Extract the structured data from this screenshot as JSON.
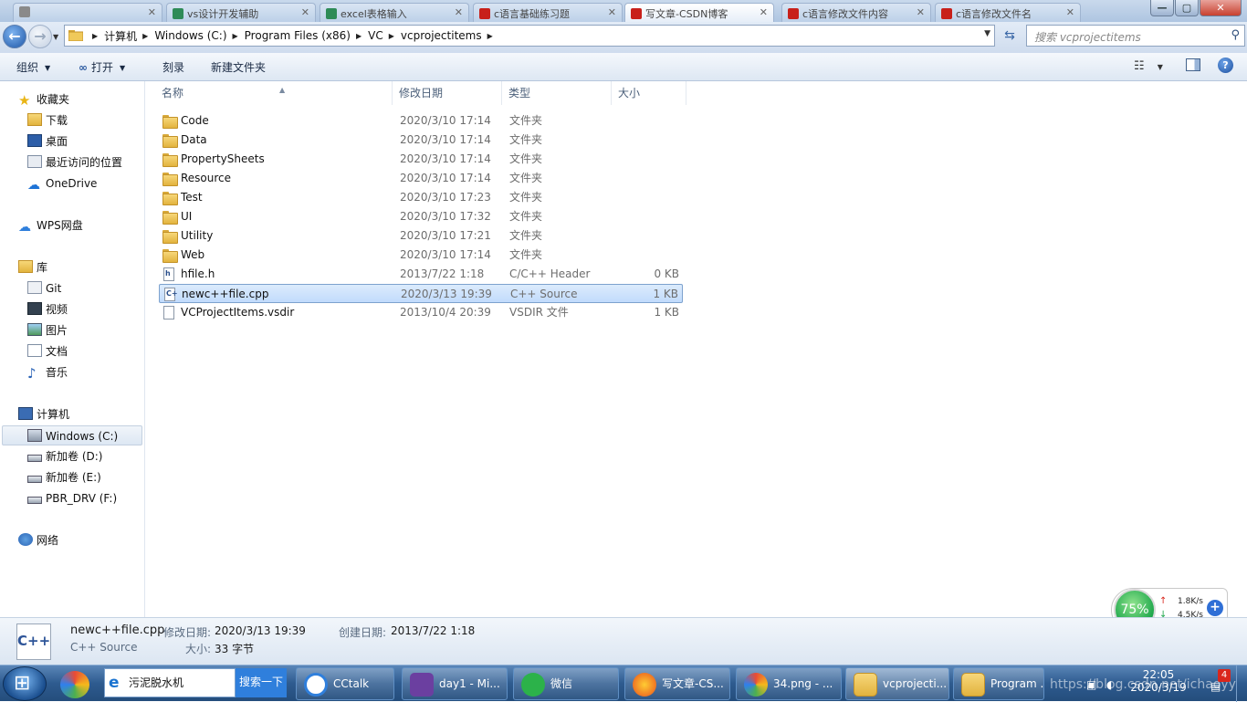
{
  "browser_tabs": [
    {
      "title": "",
      "color": "#8a8a8a"
    },
    {
      "title": "vs设计开发辅助",
      "color": "#2e8b57"
    },
    {
      "title": "excel表格输入",
      "color": "#2e8b57"
    },
    {
      "title": "c语言基础练习题",
      "color": "#c8201a"
    },
    {
      "title": "写文章-CSDN博客",
      "color": "#c8201a"
    },
    {
      "title": "c语言修改文件内容",
      "color": "#c8201a"
    },
    {
      "title": "c语言修改文件名",
      "color": "#c8201a"
    }
  ],
  "address": {
    "crumbs": [
      "计算机",
      "Windows (C:)",
      "Program Files (x86)",
      "VC",
      "vcprojectitems"
    ],
    "search_placeholder": "搜索 vcprojectitems"
  },
  "toolbar": {
    "organize": "组织",
    "open": "打开",
    "burn": "刻录",
    "new_folder": "新建文件夹"
  },
  "nav": {
    "favorites": "收藏夹",
    "downloads": "下载",
    "desktop": "桌面",
    "recent": "最近访问的位置",
    "onedrive": "OneDrive",
    "wps": "WPS网盘",
    "library": "库",
    "git": "Git",
    "video": "视频",
    "pictures": "图片",
    "documents": "文档",
    "music": "音乐",
    "computer": "计算机",
    "drive_c": "Windows (C:)",
    "drive_d": "新加卷 (D:)",
    "drive_e": "新加卷 (E:)",
    "drive_f": "PBR_DRV (F:)",
    "network": "网络"
  },
  "columns": {
    "name": "名称",
    "date": "修改日期",
    "type": "类型",
    "size": "大小"
  },
  "files": [
    {
      "name": "Code",
      "date": "2020/3/10 17:14",
      "type": "文件夹",
      "size": "",
      "icon": "folder"
    },
    {
      "name": "Data",
      "date": "2020/3/10 17:14",
      "type": "文件夹",
      "size": "",
      "icon": "folder"
    },
    {
      "name": "PropertySheets",
      "date": "2020/3/10 17:14",
      "type": "文件夹",
      "size": "",
      "icon": "folder"
    },
    {
      "name": "Resource",
      "date": "2020/3/10 17:14",
      "type": "文件夹",
      "size": "",
      "icon": "folder"
    },
    {
      "name": "Test",
      "date": "2020/3/10 17:23",
      "type": "文件夹",
      "size": "",
      "icon": "folder"
    },
    {
      "name": "UI",
      "date": "2020/3/10 17:32",
      "type": "文件夹",
      "size": "",
      "icon": "folder"
    },
    {
      "name": "Utility",
      "date": "2020/3/10 17:21",
      "type": "文件夹",
      "size": "",
      "icon": "folder"
    },
    {
      "name": "Web",
      "date": "2020/3/10 17:14",
      "type": "文件夹",
      "size": "",
      "icon": "folder"
    },
    {
      "name": "hfile.h",
      "date": "2013/7/22 1:18",
      "type": "C/C++ Header",
      "size": "0 KB",
      "icon": "h-file"
    },
    {
      "name": "newc++file.cpp",
      "date": "2020/3/13 19:39",
      "type": "C++ Source",
      "size": "1 KB",
      "icon": "cpp-file",
      "selected": true
    },
    {
      "name": "VCProjectItems.vsdir",
      "date": "2013/10/4 20:39",
      "type": "VSDIR 文件",
      "size": "1 KB",
      "icon": "blank-file"
    }
  ],
  "details": {
    "icon_text": "C++",
    "filename": "newc++file.cpp",
    "filetype": "C++ Source",
    "modified_label": "修改日期:",
    "modified_value": "2020/3/13 19:39",
    "created_label": "创建日期:",
    "created_value": "2013/7/22 1:18",
    "size_label": "大小:",
    "size_value": "33 字节"
  },
  "taskbar": {
    "search_text": "污泥脱水机",
    "search_button": "搜索一下",
    "items": [
      "CCtalk",
      "day1 - Mi...",
      "微信",
      "写文章-CS...",
      "34.png - ...",
      "vcprojecti...",
      "Program ..."
    ],
    "clock_time": "22:05",
    "clock_date": "2020/3/19",
    "watermark": "https://blog.csdn.net/ichaoyy",
    "badge": "4"
  },
  "net_widget": {
    "percent": "75%",
    "up": "1.8K/s",
    "down": "4.5K/s"
  },
  "colors": {
    "selection": "#c1dbfc",
    "accent": "#2e5b8f"
  }
}
